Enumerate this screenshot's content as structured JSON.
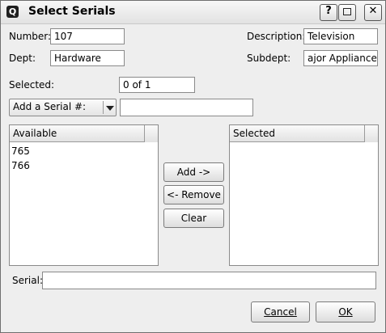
{
  "window": {
    "title": "Select Serials",
    "app_icon_glyph": "Q",
    "help_label": "?",
    "maximize_label": "□",
    "close_label": "✕"
  },
  "form": {
    "number_label": "Number:",
    "number_value": "107",
    "description_label": "Description:",
    "description_value": "Television",
    "dept_label": "Dept:",
    "dept_value": "Hardware",
    "subdept_label": "Subdept:",
    "subdept_value": "ajor Appliances",
    "selected_label": "Selected:",
    "selected_value": "0 of 1"
  },
  "add_serial": {
    "mode_selected": "Add a Serial #:",
    "input_value": ""
  },
  "available_list": {
    "header": "Available",
    "items": [
      "765",
      "766"
    ]
  },
  "selected_list": {
    "header": "Selected",
    "items": []
  },
  "actions": {
    "add": "Add ->",
    "remove": "<- Remove",
    "clear": "Clear"
  },
  "serial": {
    "label": "Serial:",
    "value": ""
  },
  "footer": {
    "cancel_label": "Cancel",
    "ok_label": "OK"
  },
  "colors": {
    "dialog_bg": "#eeeeee",
    "field_bg": "#ffffff",
    "border": "#8a8a8a"
  }
}
